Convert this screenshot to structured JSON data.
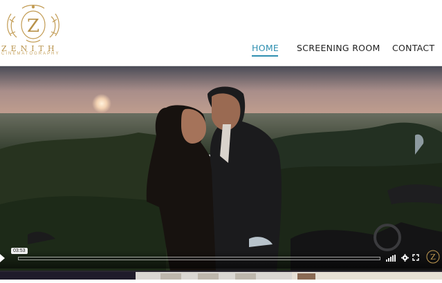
{
  "brand": {
    "monogram": "Z",
    "name": "ZENITH",
    "tagline": "CINEMATOGRAPHY",
    "gold": "#b8924a"
  },
  "nav": {
    "items": [
      {
        "label": "HOME",
        "active": true
      },
      {
        "label": "SCREENING ROOM",
        "active": false
      },
      {
        "label": "CONTACT",
        "active": false
      }
    ],
    "accent": "#2e8fb0"
  },
  "video": {
    "current_time": "03:53",
    "progress": 0.0,
    "controls": [
      "play-icon",
      "volume-icon",
      "gear-icon",
      "fullscreen-icon"
    ]
  }
}
